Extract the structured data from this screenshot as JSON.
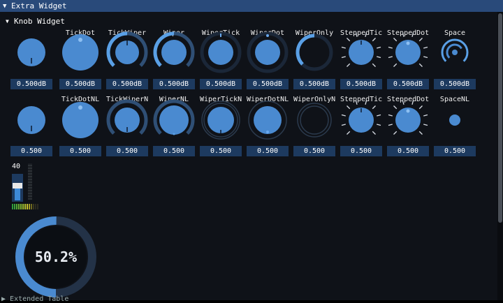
{
  "window": {
    "title": "Extra Widget",
    "arrow": "▼"
  },
  "section": {
    "title": "Knob Widget",
    "arrow": "▼"
  },
  "colors": {
    "knob": "#4a8ad0",
    "ring": "#2f4f75",
    "track": "#1b2738",
    "accent": "#5aa0e6",
    "dark": "#0f1218",
    "tick": "#ffffff"
  },
  "row1": {
    "labels": [
      "",
      "TickDot",
      "TickWiper",
      "Wiper",
      "WiperTick",
      "WiperDot",
      "WiperOnly",
      "SteppedTick",
      "SteppedDot",
      "Space"
    ],
    "values": [
      "0.500dB",
      "0.500dB",
      "0.500dB",
      "0.500dB",
      "0.500dB",
      "0.500dB",
      "0.500dB",
      "0.500dB",
      "0.500dB",
      "0.500dB"
    ],
    "styles": [
      "tick",
      "tickdot",
      "tickwiper",
      "wiper",
      "wipertick",
      "wiperdot",
      "wiperonly",
      "steppedtick",
      "steppeddot",
      "space"
    ]
  },
  "row2": {
    "labels": [
      "",
      "TickDotNL",
      "TickWiperNL",
      "WiperNL",
      "WiperTickNL",
      "WiperDotNL",
      "WiperOnlyNL",
      "SteppedTickNL",
      "SteppedDotNL",
      "SpaceNL"
    ],
    "values": [
      "0.500",
      "0.500",
      "0.500",
      "0.500",
      "0.500",
      "0.500",
      "0.500",
      "0.500",
      "0.500",
      "0.500"
    ],
    "styles": [
      "tick",
      "tickdot",
      "tickwiperNL",
      "wiperNL",
      "wipertickNL",
      "wiperdotNL",
      "wiperonlyNL",
      "steppedtick",
      "steppeddot",
      "spaceNL"
    ]
  },
  "slider": {
    "value": "40",
    "level": 0.4
  },
  "progress": {
    "label": "50.2%",
    "fraction": 0.502
  },
  "footer": {
    "label": "Extended Table"
  }
}
